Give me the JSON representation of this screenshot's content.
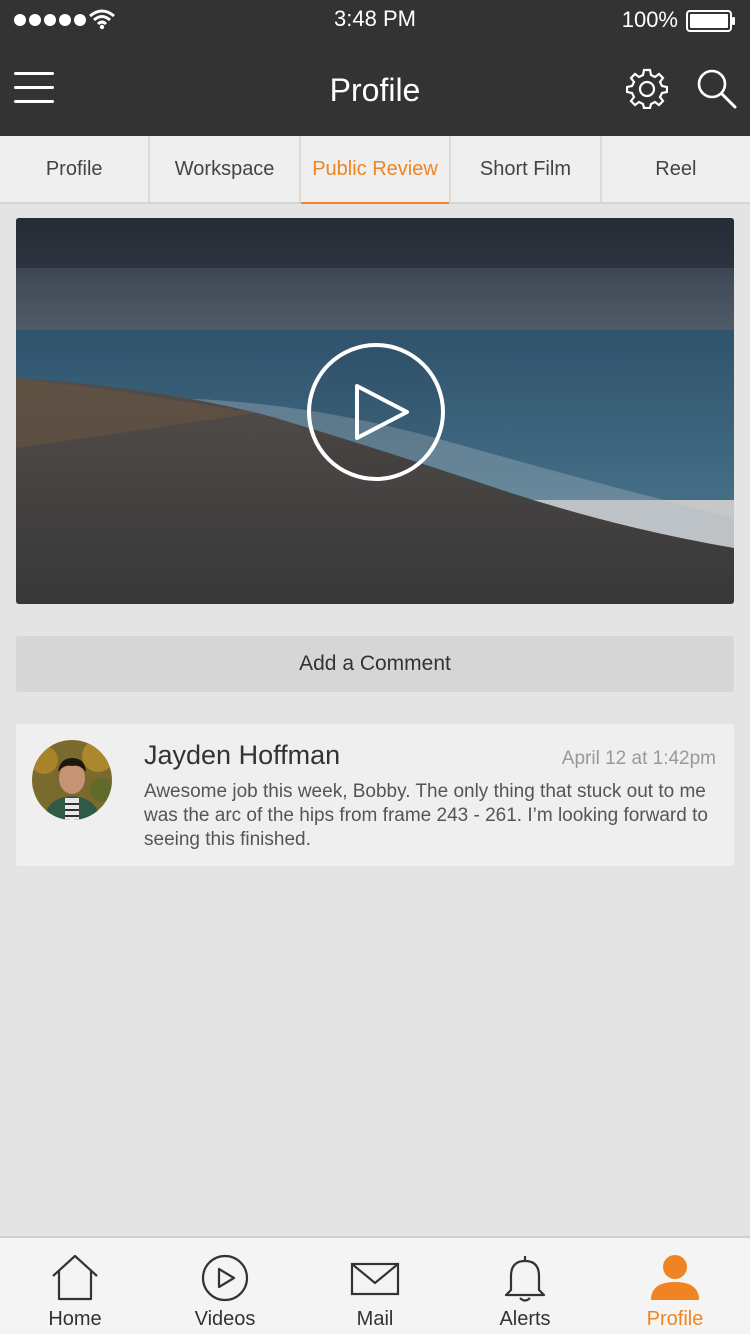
{
  "status": {
    "time": "3:48 PM",
    "battery": "100%"
  },
  "header": {
    "title": "Profile"
  },
  "tabs": [
    {
      "label": "Profile",
      "active": false
    },
    {
      "label": "Workspace",
      "active": false
    },
    {
      "label": "Public Review",
      "active": true
    },
    {
      "label": "Short Film",
      "active": false
    },
    {
      "label": "Reel",
      "active": false
    }
  ],
  "comment_button": {
    "label": "Add a Comment"
  },
  "comment": {
    "author": "Jayden Hoffman",
    "timestamp": "April 12 at 1:42pm",
    "text": "Awesome job this week, Bobby. The only thing that stuck out to me was the arc of the hips from frame 243 - 261. I’m looking forward to seeing this finished."
  },
  "bottom_nav": [
    {
      "label": "Home",
      "icon": "home-icon",
      "active": false
    },
    {
      "label": "Videos",
      "icon": "play-circle-icon",
      "active": false
    },
    {
      "label": "Mail",
      "icon": "mail-icon",
      "active": false
    },
    {
      "label": "Alerts",
      "icon": "bell-icon",
      "active": false
    },
    {
      "label": "Profile",
      "icon": "person-icon",
      "active": true
    }
  ],
  "colors": {
    "header_bg": "#333333",
    "accent": "#f08322",
    "background": "#e4e4e4"
  }
}
